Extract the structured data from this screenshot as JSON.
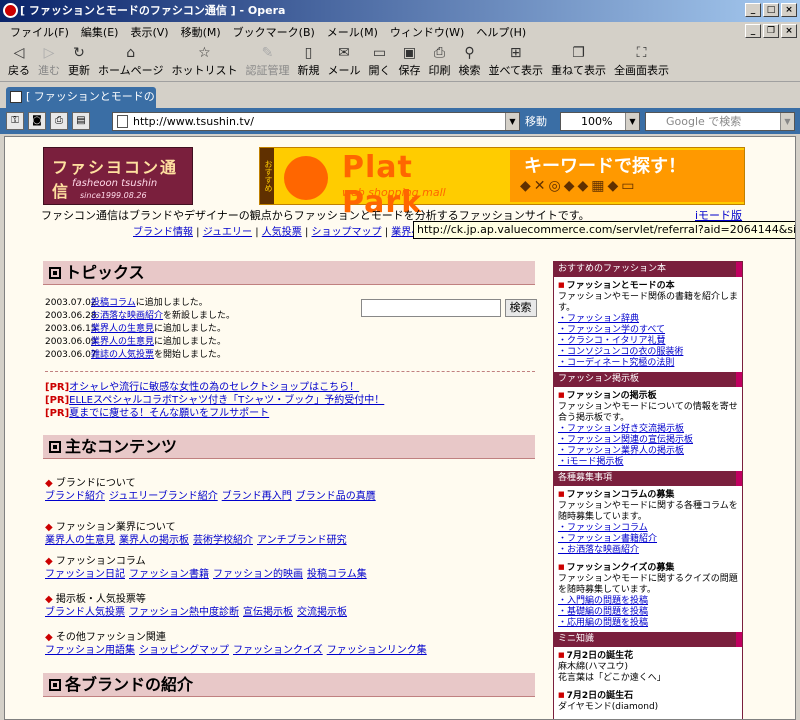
{
  "window": {
    "title": "[ ファッションとモードのファシコン通信 ] - Opera"
  },
  "menu": [
    "ファイル(F)",
    "編集(E)",
    "表示(V)",
    "移動(M)",
    "ブックマーク(B)",
    "メール(M)",
    "ウィンドウ(W)",
    "ヘルプ(H)"
  ],
  "toolbar": [
    {
      "label": "戻る",
      "icon": "back-icon",
      "glyph": "◁",
      "enabled": true
    },
    {
      "label": "進む",
      "icon": "forward-icon",
      "glyph": "▷",
      "enabled": false
    },
    {
      "label": "更新",
      "icon": "reload-icon",
      "glyph": "↻",
      "enabled": true
    },
    {
      "label": "ホームページ",
      "icon": "home-icon",
      "glyph": "⌂",
      "enabled": true
    },
    {
      "label": "ホットリスト",
      "icon": "star-icon",
      "glyph": "☆",
      "enabled": true
    },
    {
      "label": "認証管理",
      "icon": "wand-icon",
      "glyph": "✎",
      "enabled": false
    },
    {
      "label": "新規",
      "icon": "new-page-icon",
      "glyph": "▯",
      "enabled": true
    },
    {
      "label": "メール",
      "icon": "mail-icon",
      "glyph": "✉",
      "enabled": true
    },
    {
      "label": "開く",
      "icon": "folder-icon",
      "glyph": "▭",
      "enabled": true
    },
    {
      "label": "保存",
      "icon": "save-icon",
      "glyph": "▣",
      "enabled": true
    },
    {
      "label": "印刷",
      "icon": "print-icon",
      "glyph": "⎙",
      "enabled": true
    },
    {
      "label": "検索",
      "icon": "search-icon",
      "glyph": "⚲",
      "enabled": true
    },
    {
      "label": "並べて表示",
      "icon": "tile-icon",
      "glyph": "⊞",
      "enabled": true
    },
    {
      "label": "重ねて表示",
      "icon": "cascade-icon",
      "glyph": "❐",
      "enabled": true
    },
    {
      "label": "全画面表示",
      "icon": "fullscreen-icon",
      "glyph": "⛶",
      "enabled": true
    }
  ],
  "tab": {
    "label": "[ ファッションとモードのファ..."
  },
  "address": {
    "url": "http://www.tsushin.tv/",
    "go_label": "移動",
    "zoom": "100%",
    "search_placeholder": "Google で検索"
  },
  "page": {
    "logo": {
      "title": "ファシヨコン通信",
      "sub": "fasheoon tsushin",
      "since": "since1999.08.26"
    },
    "banner": {
      "side": "おすすめ",
      "brand": "Plat Park",
      "brand_sub": "web shopping mall",
      "keyword": "キーワードで探す！"
    },
    "tagline": "ファシコン通信はブランドやデザイナーの観点からファッションとモードを分析するファッションサイトです。",
    "imode_link": "iモード版",
    "nav": [
      "ブランド情報",
      "ジュエリー",
      "人気投票",
      "ショップマップ",
      "業界ページ"
    ],
    "tooltip": "http://ck.jp.ap.valuecommerce.com/servlet/referral?aid=2064144&sid=28316",
    "topics_heading": "トピックス",
    "news": [
      {
        "date": "2003.07.02",
        "link": "投稿コラム",
        "text": "に追加しました。"
      },
      {
        "date": "2003.06.28",
        "link": "お洒落な映画紹介",
        "text": "を新設しました。"
      },
      {
        "date": "2003.06.15",
        "link": "業界人の生意見",
        "text": "に追加しました。"
      },
      {
        "date": "2003.06.09",
        "link": "業界人の生意見",
        "text": "に追加しました。"
      },
      {
        "date": "2003.06.07",
        "link": "雑誌の人気投票",
        "text": "を開始しました。"
      }
    ],
    "search_button": "検索",
    "pr": [
      {
        "tag": "[PR]",
        "text": "オシャレや流行に敏感な女性の為のセレクトショップはこちら！"
      },
      {
        "tag": "[PR]",
        "text": "ELLEスペシャルコラボTシャツ付き「Tシャツ・ブック」予約受付中！"
      },
      {
        "tag": "[PR]",
        "text": "夏までに痩せる！そんな願いをフルサポート"
      }
    ],
    "contents_heading": "主なコンテンツ",
    "sections": [
      {
        "title": "ブランドについて",
        "links": [
          "ブランド紹介",
          "ジュエリーブランド紹介",
          "ブランド再入門",
          "ブランド品の真贋"
        ]
      },
      {
        "title": "ファッション業界について",
        "links": [
          "業界人の生意見",
          "業界人の掲示板",
          "芸術学校紹介",
          "アンチブランド研究"
        ]
      },
      {
        "title": "ファッションコラム",
        "links": [
          "ファッション日記",
          "ファッション書籍",
          "ファッション的映画",
          "投稿コラム集"
        ]
      },
      {
        "title": "掲示板・人気投票等",
        "links": [
          "ブランド人気投票",
          "ファッション熱中度診断",
          "宣伝掲示板",
          "交流掲示板"
        ]
      },
      {
        "title": "その他ファッション関連",
        "links": [
          "ファッション用語集",
          "ショッピングマップ",
          "ファッションクイズ",
          "ファッションリンク集"
        ]
      }
    ],
    "brands_heading": "各ブランドの紹介",
    "sidebar": [
      {
        "heading": "おすすめのファッション本",
        "blocks": [
          {
            "title": "ファッションとモードの本",
            "desc": "ファッションやモード関係の書籍を紹介します。",
            "links": [
              "ファッション辞典",
              "ファッション学のすべて",
              "クラシコ・イタリア礼賛",
              "コンソジュンコの衣の服装術",
              "コーディネート究極の法則"
            ]
          }
        ]
      },
      {
        "heading": "ファッション掲示板",
        "blocks": [
          {
            "title": "ファッションの掲示板",
            "desc": "ファッションやモードについての情報を寄せ合う掲示板です。",
            "links": [
              "ファッション好き交流掲示板",
              "ファッション関連の宣伝掲示板",
              "ファッション業界人の掲示板",
              "iモード掲示板"
            ]
          }
        ]
      },
      {
        "heading": "各種募集事項",
        "blocks": [
          {
            "title": "ファッションコラムの募集",
            "desc": "ファッションやモードに関する各種コラムを随時募集しています。",
            "links": [
              "ファッションコラム",
              "ファッション書籍紹介",
              "お洒落な映画紹介"
            ]
          },
          {
            "title": "ファッションクイズの募集",
            "desc": "ファッションやモードに関するクイズの問題を随時募集しています。",
            "links": [
              "入門編の問題を投稿",
              "基礎編の問題を投稿",
              "応用編の問題を投稿"
            ]
          }
        ]
      },
      {
        "heading": "ミニ知識",
        "blocks": [
          {
            "title": "7月2日の誕生花",
            "desc": "麻木綿(ハマユウ)\n花言葉は「どこか遠くへ」",
            "links": []
          },
          {
            "title": "7月2日の誕生石",
            "desc": "ダイヤモンド(diamond)",
            "links": []
          }
        ]
      }
    ]
  },
  "colors": {
    "accent": "#7a1f3d",
    "heading_bg": "#e8c8c8",
    "link": "#0000cc",
    "pr": "#cc0000"
  }
}
